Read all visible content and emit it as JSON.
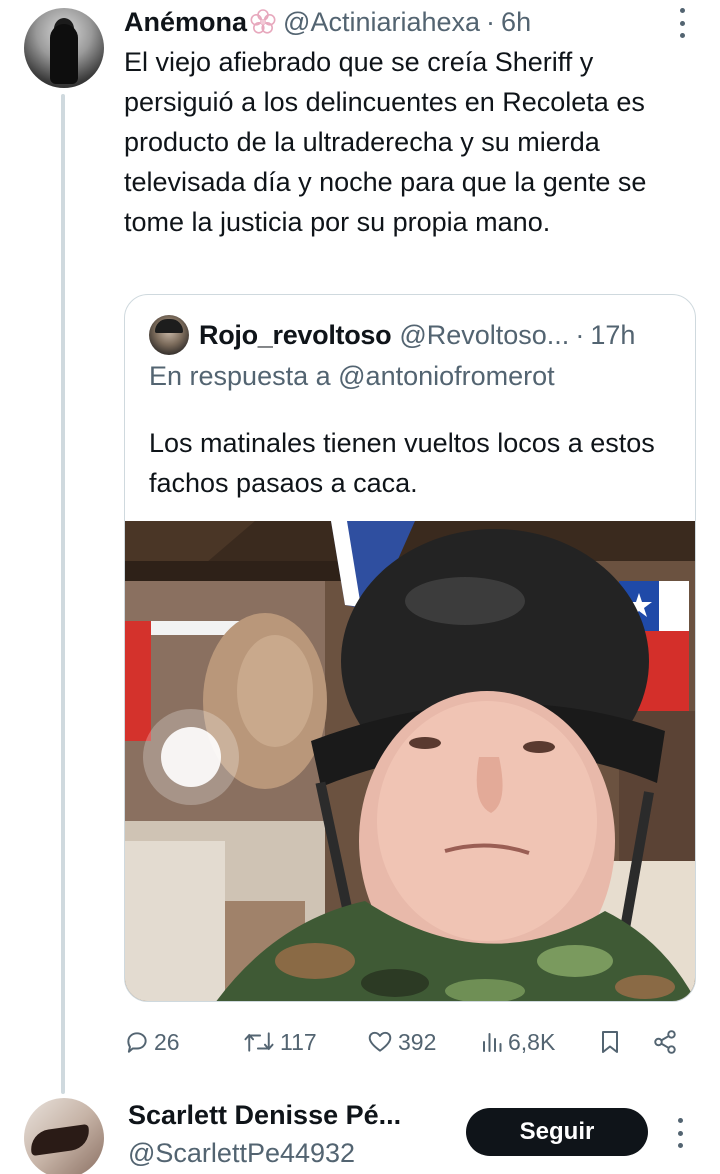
{
  "tweet": {
    "author": {
      "display_name": "Anémona",
      "handle": "@Actiniariahexa",
      "time": "6h"
    },
    "text": "El viejo afiebrado que se creía Sheriff y persiguió a los delincuentes en Recoleta es producto de la ultraderecha y su mierda televisada día y noche para que la gente se tome la justicia por su propia mano.",
    "quote": {
      "display_name": "Rojo_revoltoso",
      "handle": "@Revoltoso...",
      "time": "17h",
      "reply_prefix": "En respuesta a",
      "reply_mention": "@antoniofromerot",
      "text": "Los matinales tienen vueltos locos a estos fachos pasaos a caca."
    },
    "actions": {
      "replies": "26",
      "retweets": "117",
      "likes": "392",
      "views": "6,8K"
    }
  },
  "suggestion": {
    "display_name": "Scarlett Denisse Pé...",
    "handle": "@ScarlettPe44932",
    "follow_label": "Seguir"
  },
  "colors": {
    "text_primary": "#0f1419",
    "text_secondary": "#536471",
    "border": "#cfd9de",
    "follow_button_bg": "#0f1419"
  }
}
